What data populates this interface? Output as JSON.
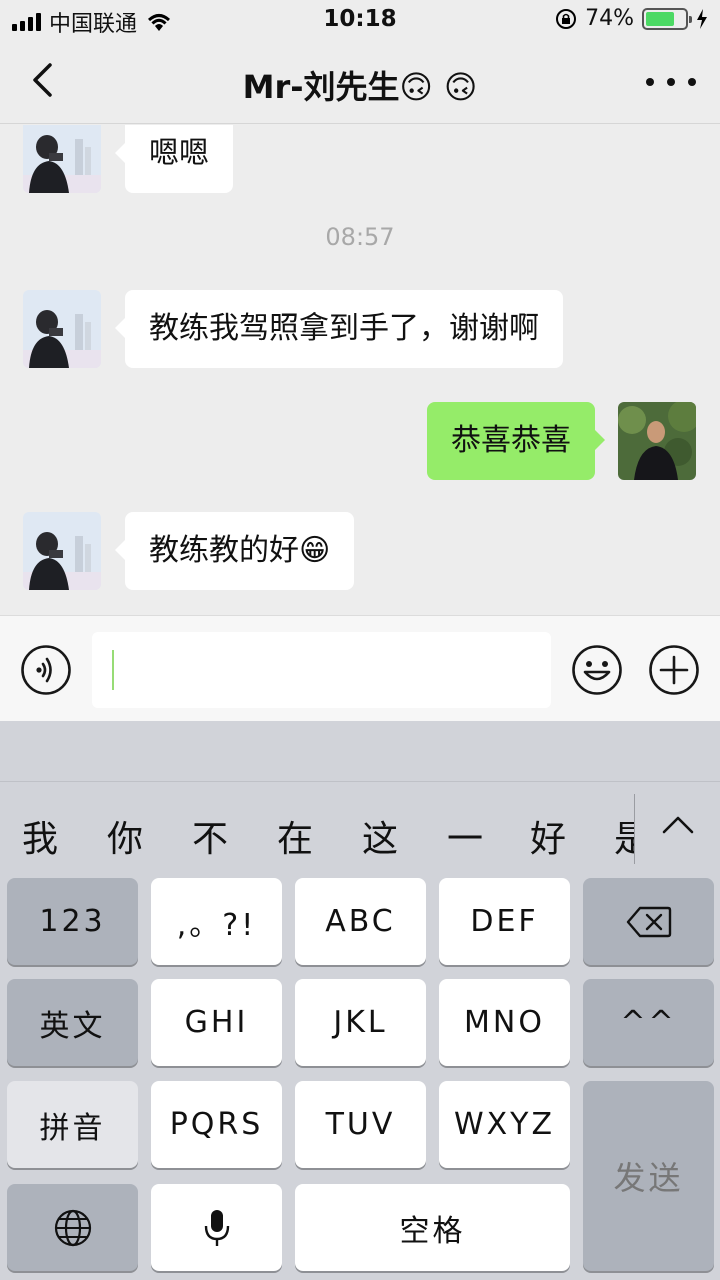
{
  "status_bar": {
    "carrier": "中国联通",
    "time": "10:18",
    "battery": "74%",
    "battery_level": 0.74
  },
  "nav": {
    "title": "Mr-刘先生🙃 🙃"
  },
  "chat": {
    "messages": [
      {
        "direction": "in",
        "text": "嗯嗯"
      },
      {
        "direction": "in",
        "text": "教练我驾照拿到手了，谢谢啊"
      },
      {
        "direction": "out",
        "text": "恭喜恭喜"
      },
      {
        "direction": "in",
        "text": "教练教的好😁"
      }
    ],
    "timestamp": "08:57"
  },
  "keyboard": {
    "candidates": [
      "我",
      "你",
      "不",
      "在",
      "这",
      "一",
      "好",
      "是"
    ],
    "keys": {
      "num": "123",
      "punct": ",。?!",
      "abc": "ABC",
      "def": "DEF",
      "english": "英文",
      "ghi": "GHI",
      "jkl": "JKL",
      "mno": "MNO",
      "emoticon": "^^",
      "pinyin": "拼音",
      "pqrs": "PQRS",
      "tuv": "TUV",
      "wxyz": "WXYZ",
      "send": "发送",
      "space": "空格"
    }
  },
  "colors": {
    "background": "#ededed",
    "outgoing_bubble": "#95ec69",
    "incoming_bubble": "#ffffff",
    "keyboard_bg": "#d1d3d9",
    "battery_green": "#4cd964"
  }
}
